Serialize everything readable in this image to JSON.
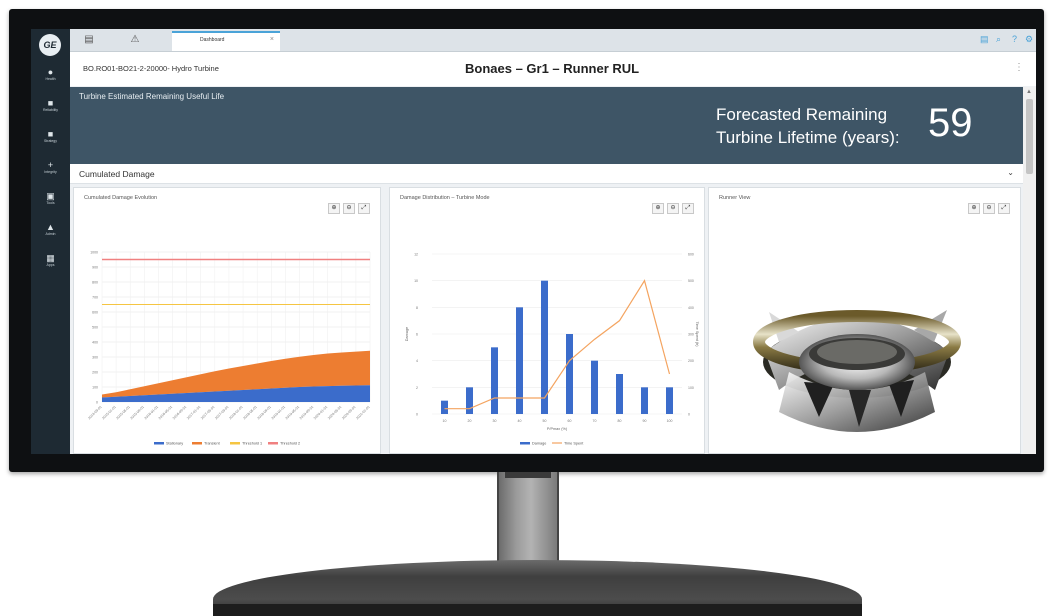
{
  "app": {
    "logo_text": "GE",
    "tab_label": "Dashboard",
    "tab_close": "×"
  },
  "sidebar": {
    "items": [
      {
        "icon": "●",
        "label": "Health"
      },
      {
        "icon": "■",
        "label": "Reliability"
      },
      {
        "icon": "■",
        "label": "Strategy"
      },
      {
        "icon": "+",
        "label": "Integrity"
      },
      {
        "icon": "▣",
        "label": "Tools"
      },
      {
        "icon": "▲",
        "label": "Admin"
      },
      {
        "icon": "▦",
        "label": "Apps"
      }
    ]
  },
  "toolbar": {
    "right_icons": [
      "▤",
      "⌕",
      "?",
      "⚙"
    ]
  },
  "header": {
    "asset_path": "BO.RO01-BO21-2-20000- Hydro Turbine",
    "title": "Bonaes – Gr1 – Runner RUL",
    "menu": "⋮"
  },
  "banner": {
    "title": "Turbine Estimated Remaining Useful Life",
    "forecast_label_line1": "Forecasted Remaining",
    "forecast_label_line2": "Turbine Lifetime (years):",
    "forecast_value": "59"
  },
  "accordion": {
    "label": "Cumulated Damage",
    "chevron": "⌄"
  },
  "panels": {
    "damage_evolution": {
      "title": "Cumulated Damage Evolution"
    },
    "damage_distribution": {
      "title": "Damage Distribution – Turbine Mode"
    },
    "runner_view": {
      "title": "Runner View"
    },
    "buttons": [
      "⊕",
      "⊖",
      "⤢"
    ]
  },
  "colors": {
    "banner": "#3e5566",
    "stationary": "#3b6ccb",
    "transient": "#ed7d31",
    "threshold1": "#f5c542",
    "threshold2": "#f08080",
    "bars": "#3b6ccb",
    "line": "#f4a460"
  },
  "chart_data": [
    {
      "type": "area",
      "title": "Cumulated Damage Evolution",
      "ylim": [
        0,
        1000
      ],
      "yticks": [
        "0",
        "100",
        "200",
        "300",
        "400",
        "500",
        "600",
        "700",
        "800",
        "900",
        "1000"
      ],
      "categories": [
        "2014-09-01",
        "2015-01-01",
        "2015-05-01",
        "2015-09-01",
        "2016-01-01",
        "2016-05-01",
        "2016-09-01",
        "2017-01-01",
        "2017-05-01",
        "2017-09-01",
        "2018-01-01",
        "2018-05-01",
        "2018-09-01",
        "2019-01-01",
        "2019-05-01",
        "2019-09-01",
        "2020-01-01",
        "2020-05-01",
        "2020-09-01",
        "2021-01-01"
      ],
      "series": [
        {
          "name": "Stationary",
          "values": [
            30,
            35,
            40,
            45,
            50,
            55,
            60,
            65,
            70,
            75,
            80,
            85,
            90,
            95,
            100,
            103,
            106,
            108,
            110,
            112
          ]
        },
        {
          "name": "Transient",
          "values": [
            20,
            30,
            45,
            60,
            75,
            90,
            105,
            120,
            135,
            148,
            160,
            172,
            183,
            193,
            202,
            210,
            217,
            222,
            226,
            230
          ]
        },
        {
          "name": "Threshold 1",
          "values": [
            650,
            650,
            650,
            650,
            650,
            650,
            650,
            650,
            650,
            650,
            650,
            650,
            650,
            650,
            650,
            650,
            650,
            650,
            650,
            650
          ]
        },
        {
          "name": "Threshold 2",
          "values": [
            950,
            950,
            950,
            950,
            950,
            950,
            950,
            950,
            950,
            950,
            950,
            950,
            950,
            950,
            950,
            950,
            950,
            950,
            950,
            950
          ]
        }
      ],
      "legend": [
        "Stationary",
        "Transient",
        "Threshold 1",
        "Threshold 2"
      ],
      "legend_position": "bottom",
      "grid": true
    },
    {
      "type": "bar",
      "title": "Damage Distribution – Turbine Mode",
      "categories": [
        "10",
        "20",
        "30",
        "40",
        "50",
        "60",
        "70",
        "80",
        "90",
        "100"
      ],
      "xlabel": "P/Pmax (%)",
      "ylabel": "Damage",
      "y2label": "Time Spent (h)",
      "ylim": [
        0,
        12
      ],
      "yticks": [
        "0",
        "2",
        "4",
        "6",
        "8",
        "10",
        "12"
      ],
      "y2lim": [
        0,
        600
      ],
      "y2ticks": [
        "0",
        "100",
        "200",
        "300",
        "400",
        "500",
        "600"
      ],
      "series": [
        {
          "name": "Damage",
          "type": "bar",
          "values": [
            1,
            2,
            5,
            8,
            10,
            6,
            4,
            3,
            2,
            2
          ]
        },
        {
          "name": "Time Spent",
          "type": "line",
          "axis": "y2",
          "values": [
            20,
            20,
            60,
            60,
            60,
            200,
            280,
            350,
            500,
            150
          ]
        }
      ],
      "legend": [
        "Damage",
        "Time Spent"
      ],
      "legend_position": "bottom",
      "grid": true
    }
  ]
}
